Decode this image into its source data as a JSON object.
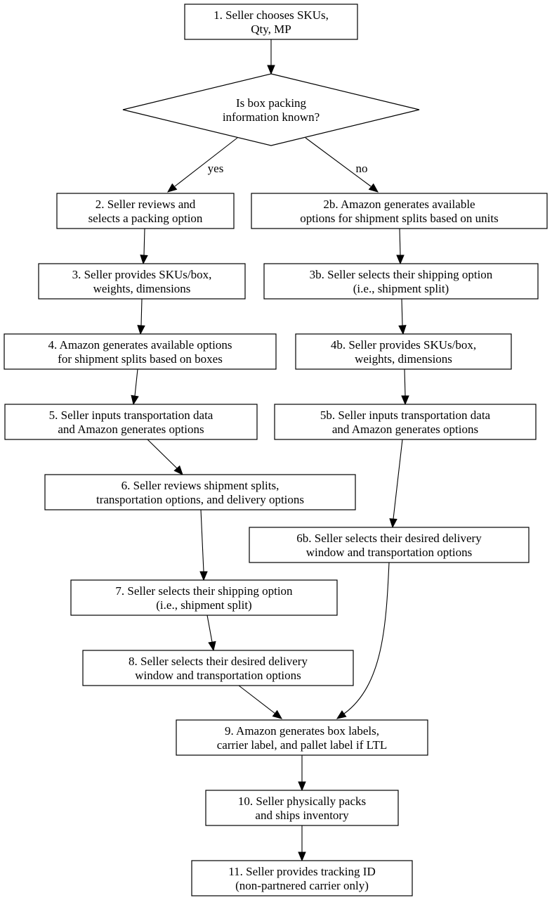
{
  "diagram": {
    "type": "flowchart",
    "nodes": [
      {
        "id": "n1",
        "shape": "box",
        "lines": [
          "1. Seller chooses SKUs,",
          "Qty, MP"
        ]
      },
      {
        "id": "d",
        "shape": "diamond",
        "lines": [
          "Is box packing",
          "information known?"
        ]
      },
      {
        "id": "n2",
        "shape": "box",
        "lines": [
          "2. Seller reviews and",
          "selects a packing option"
        ]
      },
      {
        "id": "n2b",
        "shape": "box",
        "lines": [
          "2b. Amazon generates available",
          "options for shipment splits based on units"
        ]
      },
      {
        "id": "n3",
        "shape": "box",
        "lines": [
          "3. Seller provides SKUs/box,",
          "weights, dimensions"
        ]
      },
      {
        "id": "n3b",
        "shape": "box",
        "lines": [
          "3b. Seller selects their shipping option",
          "(i.e., shipment split)"
        ]
      },
      {
        "id": "n4",
        "shape": "box",
        "lines": [
          "4. Amazon generates available options",
          "for shipment splits based on boxes"
        ]
      },
      {
        "id": "n4b",
        "shape": "box",
        "lines": [
          "4b. Seller provides SKUs/box,",
          "weights, dimensions"
        ]
      },
      {
        "id": "n5",
        "shape": "box",
        "lines": [
          "5. Seller inputs transportation data",
          "and Amazon generates options"
        ]
      },
      {
        "id": "n5b",
        "shape": "box",
        "lines": [
          "5b. Seller inputs transportation data",
          "and Amazon generates options"
        ]
      },
      {
        "id": "n6",
        "shape": "box",
        "lines": [
          "6. Seller reviews shipment splits,",
          "transportation options, and delivery options"
        ]
      },
      {
        "id": "n6b",
        "shape": "box",
        "lines": [
          "6b. Seller selects their desired delivery",
          "window and transportation options"
        ]
      },
      {
        "id": "n7",
        "shape": "box",
        "lines": [
          "7. Seller selects their shipping option",
          "(i.e., shipment split)"
        ]
      },
      {
        "id": "n8",
        "shape": "box",
        "lines": [
          "8. Seller selects their desired delivery",
          "window and transportation options"
        ]
      },
      {
        "id": "n9",
        "shape": "box",
        "lines": [
          "9. Amazon generates box labels,",
          "carrier label, and pallet label if LTL"
        ]
      },
      {
        "id": "n10",
        "shape": "box",
        "lines": [
          "10. Seller physically packs",
          "and ships inventory"
        ]
      },
      {
        "id": "n11",
        "shape": "box",
        "lines": [
          "11. Seller provides tracking ID",
          "(non-partnered carrier only)"
        ]
      }
    ],
    "edges": [
      {
        "from": "n1",
        "to": "d",
        "label": ""
      },
      {
        "from": "d",
        "to": "n2",
        "label": "yes"
      },
      {
        "from": "d",
        "to": "n2b",
        "label": "no"
      },
      {
        "from": "n2",
        "to": "n3",
        "label": ""
      },
      {
        "from": "n2b",
        "to": "n3b",
        "label": ""
      },
      {
        "from": "n3",
        "to": "n4",
        "label": ""
      },
      {
        "from": "n3b",
        "to": "n4b",
        "label": ""
      },
      {
        "from": "n4",
        "to": "n5",
        "label": ""
      },
      {
        "from": "n4b",
        "to": "n5b",
        "label": ""
      },
      {
        "from": "n5",
        "to": "n6",
        "label": ""
      },
      {
        "from": "n5b",
        "to": "n6b",
        "label": ""
      },
      {
        "from": "n6",
        "to": "n7",
        "label": ""
      },
      {
        "from": "n6b",
        "to": "n9",
        "label": ""
      },
      {
        "from": "n7",
        "to": "n8",
        "label": ""
      },
      {
        "from": "n8",
        "to": "n9",
        "label": ""
      },
      {
        "from": "n9",
        "to": "n10",
        "label": ""
      },
      {
        "from": "n10",
        "to": "n11",
        "label": ""
      }
    ]
  }
}
